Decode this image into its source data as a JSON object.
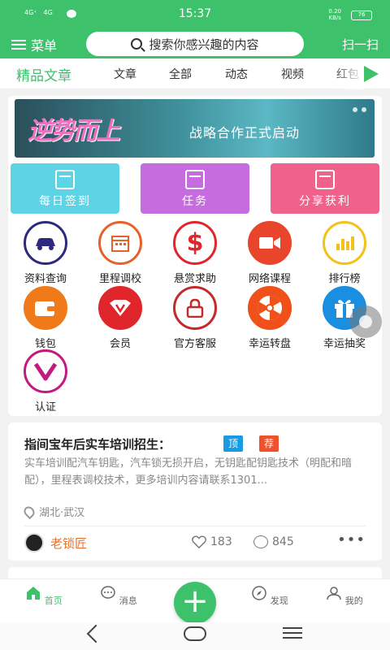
{
  "status": {
    "signal1": "4G⁺",
    "signal2": "4G",
    "time": "15:37",
    "speed_value": "0.20",
    "speed_unit": "KB/s",
    "battery": "76"
  },
  "header": {
    "menu_label": "菜单",
    "search_placeholder": "搜索你感兴趣的内容",
    "scan_label": "扫一扫"
  },
  "tabs": [
    {
      "label": "精品文章",
      "active": true
    },
    {
      "label": "文章"
    },
    {
      "label": "全部"
    },
    {
      "label": "动态"
    },
    {
      "label": "视频"
    },
    {
      "label": "红包"
    }
  ],
  "banner": {
    "title": "逆势而上",
    "subtitle": "战略合作正式启动"
  },
  "actions": [
    {
      "label": "每日签到",
      "color": "#5fd3e6"
    },
    {
      "label": "任务",
      "color": "#c66be0"
    },
    {
      "label": "分享获利",
      "color": "#f0628a"
    }
  ],
  "grid": [
    {
      "label": "资料查询",
      "color": "#2d2a7e",
      "icon": "car-icon"
    },
    {
      "label": "里程调校",
      "color": "#e8612c",
      "icon": "calendar-icon"
    },
    {
      "label": "悬赏求助",
      "color": "#e0262a",
      "icon": "dollar-icon"
    },
    {
      "label": "网络课程",
      "color": "#e8452c",
      "icon": "video-camera-icon"
    },
    {
      "label": "排行榜",
      "color": "#f2c21a",
      "icon": "bar-chart-icon"
    },
    {
      "label": "钱包",
      "color": "#f07a1a",
      "icon": "wallet-icon"
    },
    {
      "label": "会员",
      "color": "#e0262a",
      "icon": "vip-icon"
    },
    {
      "label": "官方客服",
      "color": "#c42a2a",
      "icon": "lock-icon"
    },
    {
      "label": "幸运转盘",
      "color": "#f0501a",
      "icon": "wheel-icon"
    },
    {
      "label": "幸运抽奖",
      "color": "#1a8ee0",
      "icon": "gift-icon"
    },
    {
      "label": "认证",
      "color": "#c21a7e",
      "icon": "verified-icon"
    }
  ],
  "article": {
    "title": "指间宝年后实车培训招生：",
    "tag_top": "顶",
    "tag_rec": "荐",
    "body": "实车培训配汽车钥匙，汽车锁无损开启，无钥匙配钥匙技术（明配和暗配），里程表调校技术，更多培训内容请联系1301...",
    "location": "湖北·武汉",
    "author": "老锁匠",
    "likes": "183",
    "comments": "845"
  },
  "tabbar": [
    {
      "label": "首页",
      "active": true
    },
    {
      "label": "消息"
    },
    {
      "label": "发现"
    },
    {
      "label": "我的"
    }
  ],
  "fab_symbol": "+"
}
